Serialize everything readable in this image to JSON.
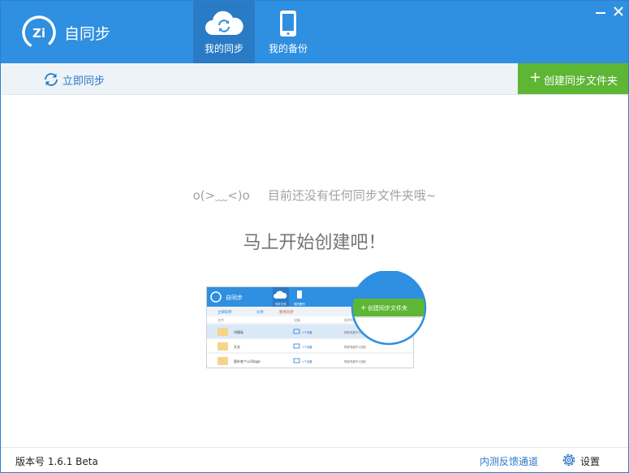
{
  "app": {
    "name": "自同步",
    "logo_text": "Zi"
  },
  "tabs": [
    {
      "label": "我的同步",
      "icon": "cloud-sync-icon",
      "active": true
    },
    {
      "label": "我的备份",
      "icon": "phone-icon",
      "active": false
    }
  ],
  "window": {
    "minimize": "—",
    "close": "✕"
  },
  "toolbar": {
    "sync_now": "立即同步",
    "create_folder": "创建同步文件夹",
    "plus": "+"
  },
  "empty": {
    "face": "o(>﹏<)o",
    "message": "目前还没有任何同步文件夹哦~",
    "cta": "马上开始创建吧！"
  },
  "illustration": {
    "app_name": "自同步",
    "tabs": [
      "同步文件",
      "我的备份"
    ],
    "toolbar": [
      "立即同步",
      "分享",
      "暂停同步"
    ],
    "columns": [
      "文件",
      "设备",
      "同步时间"
    ],
    "rows": [
      {
        "name": "UI图标",
        "devices": "1个设备",
        "status": "同步完成于1日前"
      },
      {
        "name": "天文",
        "devices": "1个设备",
        "status": "同步完成于1日前"
      },
      {
        "name": "国外各个公司logo",
        "devices": "1个设备",
        "status": "同步完成于1日前"
      }
    ],
    "zoom_button": "创建同步文件夹"
  },
  "footer": {
    "version": "版本号 1.6.1 Beta",
    "feedback": "内测反馈通道",
    "settings": "设置"
  },
  "colors": {
    "header": "#2f8fe0",
    "accent_green": "#5db634",
    "link_blue": "#2b78c9"
  }
}
